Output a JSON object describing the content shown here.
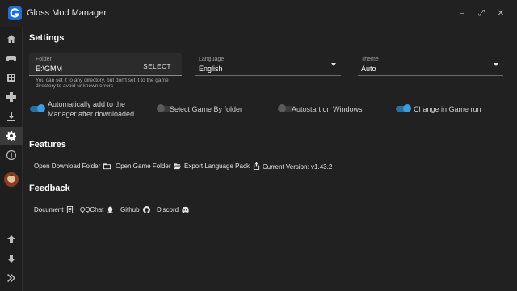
{
  "window": {
    "title": "Gloss Mod Manager",
    "minimize": "–",
    "maximize": "⤢",
    "close": "✕"
  },
  "sidebar": {
    "items": [
      {
        "icon": "home-icon"
      },
      {
        "icon": "gamepad-icon"
      },
      {
        "icon": "grid-icon"
      },
      {
        "icon": "puzzle-icon"
      },
      {
        "icon": "download-icon"
      },
      {
        "icon": "gear-icon",
        "active": true
      },
      {
        "icon": "info-icon"
      },
      {
        "icon": "avatar"
      }
    ],
    "bottom": [
      {
        "icon": "arrow-up-icon"
      },
      {
        "icon": "arrow-down-icon"
      },
      {
        "icon": "expand-icon"
      }
    ]
  },
  "settings": {
    "title": "Settings",
    "folder": {
      "label": "Folder",
      "value": "E:\\GMM",
      "button": "SELECT",
      "hint": "You can set it to any directory, but don't set it to the game directory to avoid unknown errors"
    },
    "language": {
      "label": "Language",
      "value": "English"
    },
    "theme": {
      "label": "Theme",
      "value": "Auto"
    },
    "toggles": [
      {
        "label": "Automatically add to the Manager after downloaded",
        "on": true
      },
      {
        "label": "Select Game By folder",
        "on": false
      },
      {
        "label": "Autostart on Windows",
        "on": false
      },
      {
        "label": "Change in Game run",
        "on": true
      }
    ]
  },
  "features": {
    "title": "Features",
    "open_download": "Open Download Folder",
    "open_game": "Open Game Folder",
    "export_lang": "Export Language Pack",
    "version": "Current Version: v1.43.2"
  },
  "feedback": {
    "title": "Feedback",
    "document": "Document",
    "qqchat": "QQChat",
    "github": "Github",
    "discord": "Discord"
  },
  "colors": {
    "accent": "#3c9cdf",
    "background": "#212121"
  }
}
